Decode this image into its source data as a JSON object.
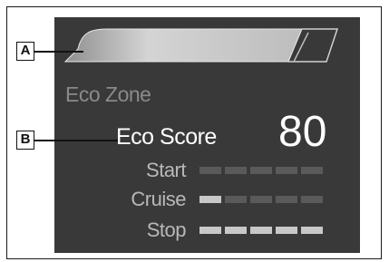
{
  "callouts": {
    "a": "A",
    "b": "B"
  },
  "display": {
    "eco_zone_label": "Eco Zone",
    "eco_score_label": "Eco Score",
    "eco_score_value": "80",
    "metrics": [
      {
        "label": "Start",
        "filled_segments": 0,
        "total_segments": 5
      },
      {
        "label": "Cruise",
        "filled_segments": 1,
        "total_segments": 5
      },
      {
        "label": "Stop",
        "filled_segments": 5,
        "total_segments": 5
      }
    ]
  },
  "colors": {
    "screen_bg": "#393939",
    "segment_on": "#c8c8c8",
    "segment_off": "#5a5a5a",
    "eco_zone_text": "#8a8a8a"
  }
}
